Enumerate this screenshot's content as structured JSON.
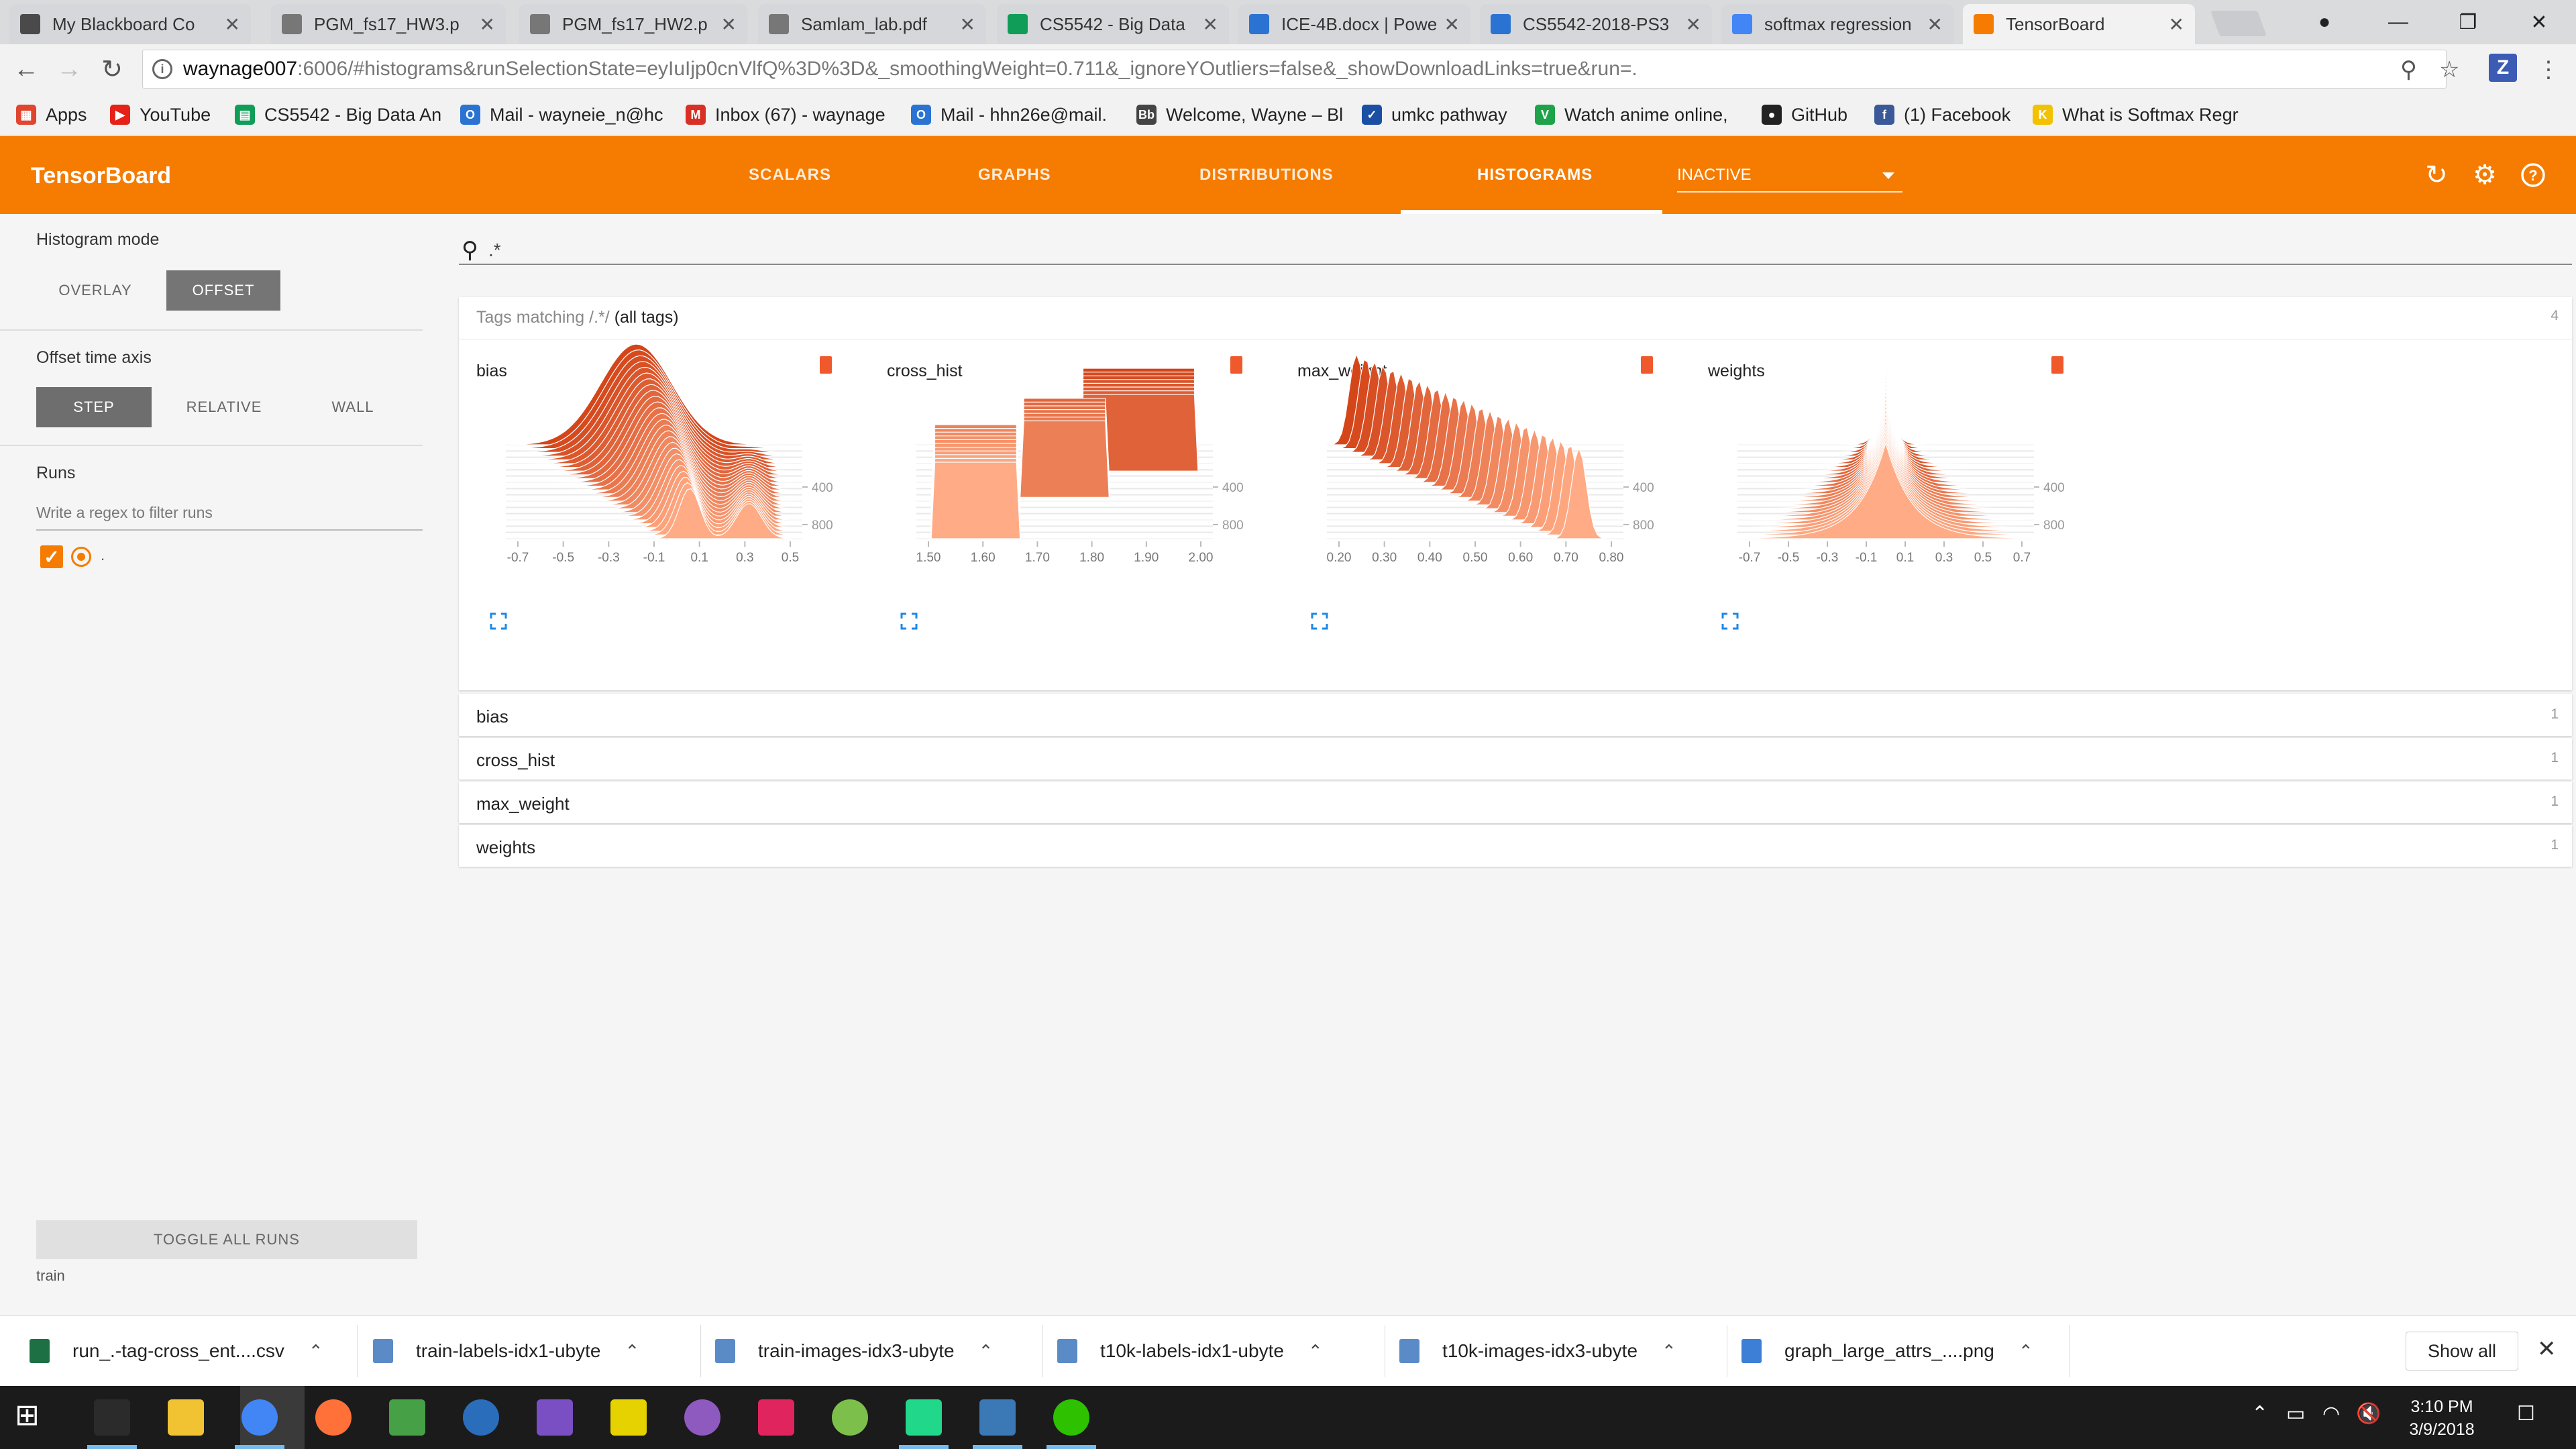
{
  "browser": {
    "tabs": [
      {
        "title": "My Blackboard Co",
        "color": "#4a4a4a"
      },
      {
        "title": "PGM_fs17_HW3.p",
        "color": "#777777"
      },
      {
        "title": "PGM_fs17_HW2.p",
        "color": "#777777"
      },
      {
        "title": "Samlam_lab.pdf",
        "color": "#777777"
      },
      {
        "title": "CS5542 - Big Data",
        "color": "#0f9d58"
      },
      {
        "title": "ICE-4B.docx | Powe",
        "color": "#2a73d2"
      },
      {
        "title": "CS5542-2018-PS3",
        "color": "#2a73d2"
      },
      {
        "title": "softmax regression",
        "color": "#4285f4"
      },
      {
        "title": "TensorBoard",
        "color": "#f57c00"
      }
    ],
    "url_host": "waynage007",
    "url_path": ":6006/#histograms&runSelectionState=eyIuIjp0cnVlfQ%3D%3D&_smoothingWeight=0.711&_ignoreYOutliers=false&_showDownloadLinks=true&run=.",
    "bookmarks": [
      {
        "label": "Apps",
        "color": "#e0452f",
        "glyph": "▦"
      },
      {
        "label": "YouTube",
        "color": "#e62117",
        "glyph": "▶"
      },
      {
        "label": "CS5542 - Big Data An",
        "color": "#0f9d58",
        "glyph": "▤"
      },
      {
        "label": "Mail - wayneie_n@hc",
        "color": "#2a73d2",
        "glyph": "O"
      },
      {
        "label": "Inbox (67) - waynage",
        "color": "#d93025",
        "glyph": "M"
      },
      {
        "label": "Mail - hhn26e@mail.",
        "color": "#2a73d2",
        "glyph": "O"
      },
      {
        "label": "Welcome, Wayne – Bl",
        "color": "#444444",
        "glyph": "Bb"
      },
      {
        "label": "umkc pathway",
        "color": "#1a4fa3",
        "glyph": "✓"
      },
      {
        "label": "Watch anime online,",
        "color": "#1ea34a",
        "glyph": "V"
      },
      {
        "label": "GitHub",
        "color": "#222222",
        "glyph": "●"
      },
      {
        "label": "(1) Facebook",
        "color": "#3b5998",
        "glyph": "f"
      },
      {
        "label": "What is Softmax Regr",
        "color": "#f2c200",
        "glyph": "K"
      }
    ]
  },
  "tensorboard": {
    "title": "TensorBoard",
    "nav": [
      "SCALARS",
      "GRAPHS",
      "DISTRIBUTIONS",
      "HISTOGRAMS"
    ],
    "inactive_label": "INACTIVE"
  },
  "sidebar": {
    "histogram_mode_label": "Histogram mode",
    "mode_overlay": "OVERLAY",
    "mode_offset": "OFFSET",
    "offset_axis_label": "Offset time axis",
    "axis_step": "STEP",
    "axis_relative": "RELATIVE",
    "axis_wall": "WALL",
    "runs_label": "Runs",
    "filter_placeholder": "Write a regex to filter runs",
    "run_name": ".",
    "toggle_all": "TOGGLE ALL RUNS",
    "footer_run": "train"
  },
  "main": {
    "search_query": ".*",
    "tags_prefix": "Tags matching /",
    "tags_regex": ".*",
    "tags_suffix": "/ ",
    "tags_all": "(all tags)",
    "tags_count": "4",
    "histograms": [
      {
        "name": "bias",
        "x_ticks": [
          "-0.7",
          "-0.5",
          "-0.3",
          "-0.1",
          "0.1",
          "0.3",
          "0.5"
        ]
      },
      {
        "name": "cross_hist",
        "x_ticks": [
          "1.50",
          "1.60",
          "1.70",
          "1.80",
          "1.90",
          "2.00"
        ]
      },
      {
        "name": "max_weight",
        "x_ticks": [
          "0.20",
          "0.30",
          "0.40",
          "0.50",
          "0.60",
          "0.70",
          "0.80"
        ]
      },
      {
        "name": "weights",
        "x_ticks": [
          "-0.7",
          "-0.5",
          "-0.3",
          "-0.1",
          "0.1",
          "0.3",
          "0.5",
          "0.7"
        ]
      }
    ],
    "y_ticks": [
      "400",
      "800"
    ],
    "rows": [
      {
        "name": "bias",
        "count": "1"
      },
      {
        "name": "cross_hist",
        "count": "1"
      },
      {
        "name": "max_weight",
        "count": "1"
      },
      {
        "name": "weights",
        "count": "1"
      }
    ]
  },
  "downloads": [
    {
      "name": "run_.-tag-cross_ent....csv",
      "color": "#1d7044"
    },
    {
      "name": "train-labels-idx1-ubyte",
      "color": "#5b8bc7"
    },
    {
      "name": "train-images-idx3-ubyte",
      "color": "#5b8bc7"
    },
    {
      "name": "t10k-labels-idx1-ubyte",
      "color": "#5b8bc7"
    },
    {
      "name": "t10k-images-idx3-ubyte",
      "color": "#5b8bc7"
    },
    {
      "name": "graph_large_attrs_....png",
      "color": "#3d7fd6"
    }
  ],
  "show_all_label": "Show all",
  "taskbar": {
    "time": "3:10 PM",
    "date": "3/9/2018",
    "apps": [
      {
        "name": "cmd",
        "color": "#2b2b2b"
      },
      {
        "name": "explorer",
        "color": "#f1c232"
      },
      {
        "name": "chrome",
        "color": "#4285f4"
      },
      {
        "name": "firefox",
        "color": "#ff7139"
      },
      {
        "name": "image-viewer",
        "color": "#46a046"
      },
      {
        "name": "r",
        "color": "#2a6ebb"
      },
      {
        "name": "visual-studio",
        "color": "#7b4fc4"
      },
      {
        "name": "webstorm",
        "color": "#e5d200"
      },
      {
        "name": "github-desktop",
        "color": "#8e5ac0"
      },
      {
        "name": "intellij",
        "color": "#e0245e"
      },
      {
        "name": "android-studio",
        "color": "#7cc04b"
      },
      {
        "name": "pycharm",
        "color": "#21d789"
      },
      {
        "name": "virtualbox",
        "color": "#3a78b6"
      },
      {
        "name": "wechat",
        "color": "#2dc100"
      }
    ]
  },
  "colors": {
    "accent": "#f57c00",
    "hist_dark": "#d4461a",
    "hist_light": "#ffab85"
  }
}
